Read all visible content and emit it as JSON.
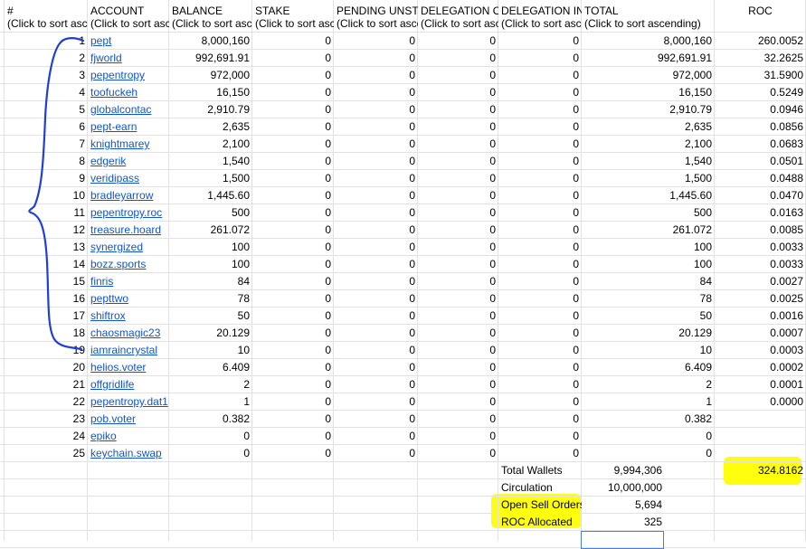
{
  "headers": [
    {
      "title": "#",
      "sub": "(Click to sort ascending)"
    },
    {
      "title": "ACCOUNT",
      "sub": "(Click to sort ascending)"
    },
    {
      "title": "BALANCE",
      "sub": "(Click to sort ascending)"
    },
    {
      "title": "STAKE",
      "sub": "(Click to sort ascending)"
    },
    {
      "title": "PENDING UNSTAKE",
      "sub": "(Click to sort ascending)"
    },
    {
      "title": "DELEGATION OUT",
      "sub": "(Click to sort ascending)"
    },
    {
      "title": "DELEGATION IN",
      "sub": "(Click to sort ascending)"
    },
    {
      "title": "TOTAL",
      "sub": "(Click to sort ascending)"
    },
    {
      "title": "ROC",
      "sub": ""
    }
  ],
  "rows": [
    {
      "n": "1",
      "account": "pept",
      "balance": "8,000,160",
      "stake": "0",
      "pending": "0",
      "dout": "0",
      "din": "0",
      "total": "8,000,160",
      "roc": "260.0052"
    },
    {
      "n": "2",
      "account": "fjworld",
      "balance": "992,691.91",
      "stake": "0",
      "pending": "0",
      "dout": "0",
      "din": "0",
      "total": "992,691.91",
      "roc": "32.2625"
    },
    {
      "n": "3",
      "account": "pepentropy",
      "balance": "972,000",
      "stake": "0",
      "pending": "0",
      "dout": "0",
      "din": "0",
      "total": "972,000",
      "roc": "31.5900"
    },
    {
      "n": "4",
      "account": "toofuckeh",
      "balance": "16,150",
      "stake": "0",
      "pending": "0",
      "dout": "0",
      "din": "0",
      "total": "16,150",
      "roc": "0.5249"
    },
    {
      "n": "5",
      "account": "globalcontac",
      "balance": "2,910.79",
      "stake": "0",
      "pending": "0",
      "dout": "0",
      "din": "0",
      "total": "2,910.79",
      "roc": "0.0946"
    },
    {
      "n": "6",
      "account": "pept-earn",
      "balance": "2,635",
      "stake": "0",
      "pending": "0",
      "dout": "0",
      "din": "0",
      "total": "2,635",
      "roc": "0.0856"
    },
    {
      "n": "7",
      "account": "knightmarey",
      "balance": "2,100",
      "stake": "0",
      "pending": "0",
      "dout": "0",
      "din": "0",
      "total": "2,100",
      "roc": "0.0683"
    },
    {
      "n": "8",
      "account": "edgerik",
      "balance": "1,540",
      "stake": "0",
      "pending": "0",
      "dout": "0",
      "din": "0",
      "total": "1,540",
      "roc": "0.0501"
    },
    {
      "n": "9",
      "account": "veridipass",
      "balance": "1,500",
      "stake": "0",
      "pending": "0",
      "dout": "0",
      "din": "0",
      "total": "1,500",
      "roc": "0.0488"
    },
    {
      "n": "10",
      "account": "bradleyarrow",
      "balance": "1,445.60",
      "stake": "0",
      "pending": "0",
      "dout": "0",
      "din": "0",
      "total": "1,445.60",
      "roc": "0.0470"
    },
    {
      "n": "11",
      "account": "pepentropy.roc",
      "balance": "500",
      "stake": "0",
      "pending": "0",
      "dout": "0",
      "din": "0",
      "total": "500",
      "roc": "0.0163"
    },
    {
      "n": "12",
      "account": "treasure.hoard",
      "balance": "261.072",
      "stake": "0",
      "pending": "0",
      "dout": "0",
      "din": "0",
      "total": "261.072",
      "roc": "0.0085"
    },
    {
      "n": "13",
      "account": "synergized",
      "balance": "100",
      "stake": "0",
      "pending": "0",
      "dout": "0",
      "din": "0",
      "total": "100",
      "roc": "0.0033"
    },
    {
      "n": "14",
      "account": "bozz.sports",
      "balance": "100",
      "stake": "0",
      "pending": "0",
      "dout": "0",
      "din": "0",
      "total": "100",
      "roc": "0.0033"
    },
    {
      "n": "15",
      "account": "finris",
      "balance": "84",
      "stake": "0",
      "pending": "0",
      "dout": "0",
      "din": "0",
      "total": "84",
      "roc": "0.0027"
    },
    {
      "n": "16",
      "account": "pepttwo",
      "balance": "78",
      "stake": "0",
      "pending": "0",
      "dout": "0",
      "din": "0",
      "total": "78",
      "roc": "0.0025"
    },
    {
      "n": "17",
      "account": "shiftrox",
      "balance": "50",
      "stake": "0",
      "pending": "0",
      "dout": "0",
      "din": "0",
      "total": "50",
      "roc": "0.0016"
    },
    {
      "n": "18",
      "account": "chaosmagic23",
      "balance": "20.129",
      "stake": "0",
      "pending": "0",
      "dout": "0",
      "din": "0",
      "total": "20.129",
      "roc": "0.0007"
    },
    {
      "n": "19",
      "account": "iamraincrystal",
      "balance": "10",
      "stake": "0",
      "pending": "0",
      "dout": "0",
      "din": "0",
      "total": "10",
      "roc": "0.0003"
    },
    {
      "n": "20",
      "account": "helios.voter",
      "balance": "6.409",
      "stake": "0",
      "pending": "0",
      "dout": "0",
      "din": "0",
      "total": "6.409",
      "roc": "0.0002"
    },
    {
      "n": "21",
      "account": "offgridlife",
      "balance": "2",
      "stake": "0",
      "pending": "0",
      "dout": "0",
      "din": "0",
      "total": "2",
      "roc": "0.0001"
    },
    {
      "n": "22",
      "account": "pepentropy.dat1",
      "balance": "1",
      "stake": "0",
      "pending": "0",
      "dout": "0",
      "din": "0",
      "total": "1",
      "roc": "0.0000"
    },
    {
      "n": "23",
      "account": "pob.voter",
      "balance": "0.382",
      "stake": "0",
      "pending": "0",
      "dout": "0",
      "din": "0",
      "total": "0.382",
      "roc": ""
    },
    {
      "n": "24",
      "account": "epiko",
      "balance": "0",
      "stake": "0",
      "pending": "0",
      "dout": "0",
      "din": "0",
      "total": "0",
      "roc": ""
    },
    {
      "n": "25",
      "account": "keychain.swap",
      "balance": "0",
      "stake": "0",
      "pending": "0",
      "dout": "0",
      "din": "0",
      "total": "0",
      "roc": ""
    }
  ],
  "summary": [
    {
      "label": "Total Wallets",
      "value": "9,994,306",
      "roc": "324.8162"
    },
    {
      "label": "Circulation",
      "value": "10,000,000",
      "roc": ""
    },
    {
      "label": "Open Sell Orders",
      "value": "5,694",
      "roc": ""
    },
    {
      "label": "ROC Allocated",
      "value": "325",
      "roc": ""
    }
  ],
  "colors": {
    "link": "#1155cc",
    "highlight": "#ffff00",
    "pen": "#1f3fd6",
    "grid": "#e2e2e2"
  }
}
